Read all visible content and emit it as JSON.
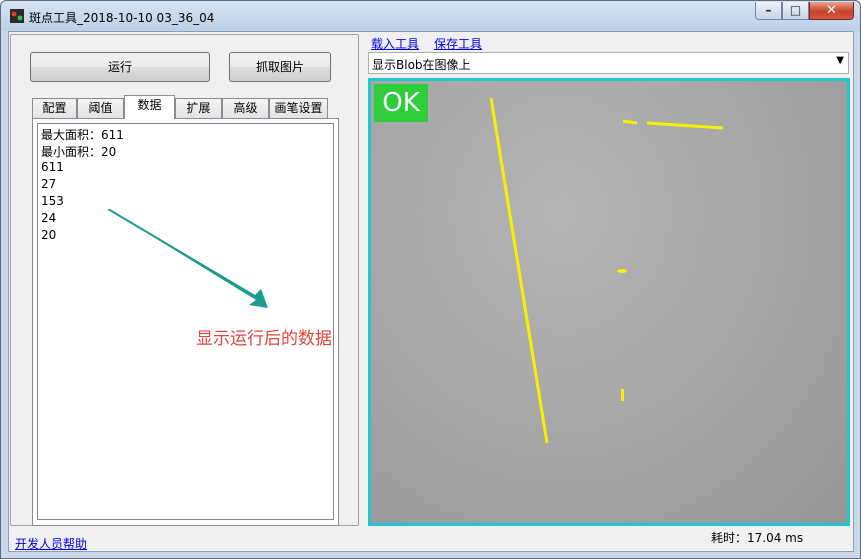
{
  "window": {
    "title": "斑点工具_2018-10-10 03_36_04",
    "controls": {
      "minimize": "–",
      "maximize": "□",
      "close": "✕"
    }
  },
  "buttons": {
    "run": "运行",
    "grab_image": "抓取图片"
  },
  "tabs": [
    {
      "label": "配置",
      "active": false
    },
    {
      "label": "阈值",
      "active": false
    },
    {
      "label": "数据",
      "active": true
    },
    {
      "label": "扩展",
      "active": false
    },
    {
      "label": "高级",
      "active": false
    },
    {
      "label": "画笔设置",
      "active": false
    }
  ],
  "data_list": [
    "最大面积：611",
    "最小面积：20",
    "611",
    "27",
    "153",
    "24",
    "20"
  ],
  "annotation": "显示运行后的数据",
  "links": {
    "load_tool": "载入工具",
    "save_tool": "保存工具",
    "dev_help": "开发人员帮助"
  },
  "display_select": {
    "value": "显示Blob在图像上"
  },
  "viewer": {
    "result_badge": "OK",
    "border_color": "#1fc7cf",
    "blob_color": "#f5f200",
    "badge_color": "#2fcc3c"
  },
  "status": {
    "elapsed": "耗时：17.04 ms"
  }
}
